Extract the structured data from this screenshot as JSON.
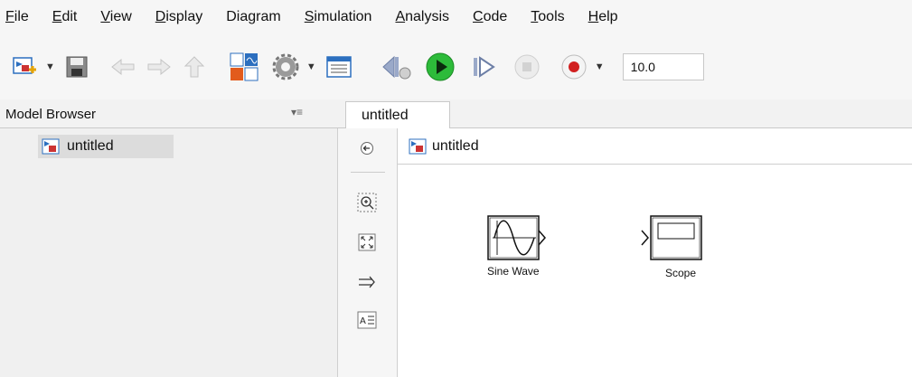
{
  "menu": {
    "items": [
      {
        "u": "F",
        "rest": "ile"
      },
      {
        "u": "E",
        "rest": "dit"
      },
      {
        "u": "V",
        "rest": "iew"
      },
      {
        "u": "D",
        "rest": "isplay"
      },
      {
        "pre": "Dia",
        "u": "g",
        "rest": "ram"
      },
      {
        "u": "S",
        "rest": "imulation"
      },
      {
        "u": "A",
        "rest": "nalysis"
      },
      {
        "u": "C",
        "rest": "ode"
      },
      {
        "u": "T",
        "rest": "ools"
      },
      {
        "u": "H",
        "rest": "elp"
      }
    ]
  },
  "toolbar": {
    "stop_time": "10.0",
    "icons": [
      "new-model-icon",
      "save-icon",
      "back-arrow-icon",
      "forward-arrow-icon",
      "up-arrow-icon",
      "library-browser-icon",
      "settings-gear-icon",
      "model-explorer-icon",
      "step-back-icon",
      "run-icon",
      "step-forward-icon",
      "stop-icon",
      "record-icon"
    ]
  },
  "model_browser": {
    "title": "Model Browser",
    "menu_glyph": "▾≡",
    "root": "untitled"
  },
  "tabs": [
    {
      "label": "untitled"
    }
  ],
  "canvas": {
    "breadcrumb": "untitled",
    "blocks": [
      {
        "label": "Sine Wave"
      },
      {
        "label": "Scope"
      }
    ]
  },
  "colors": {
    "chrome": "#f6f6f6",
    "run_green": "#2dbb3a",
    "record_red": "#d11f1f",
    "accent_blue": "#2c6fbf"
  }
}
